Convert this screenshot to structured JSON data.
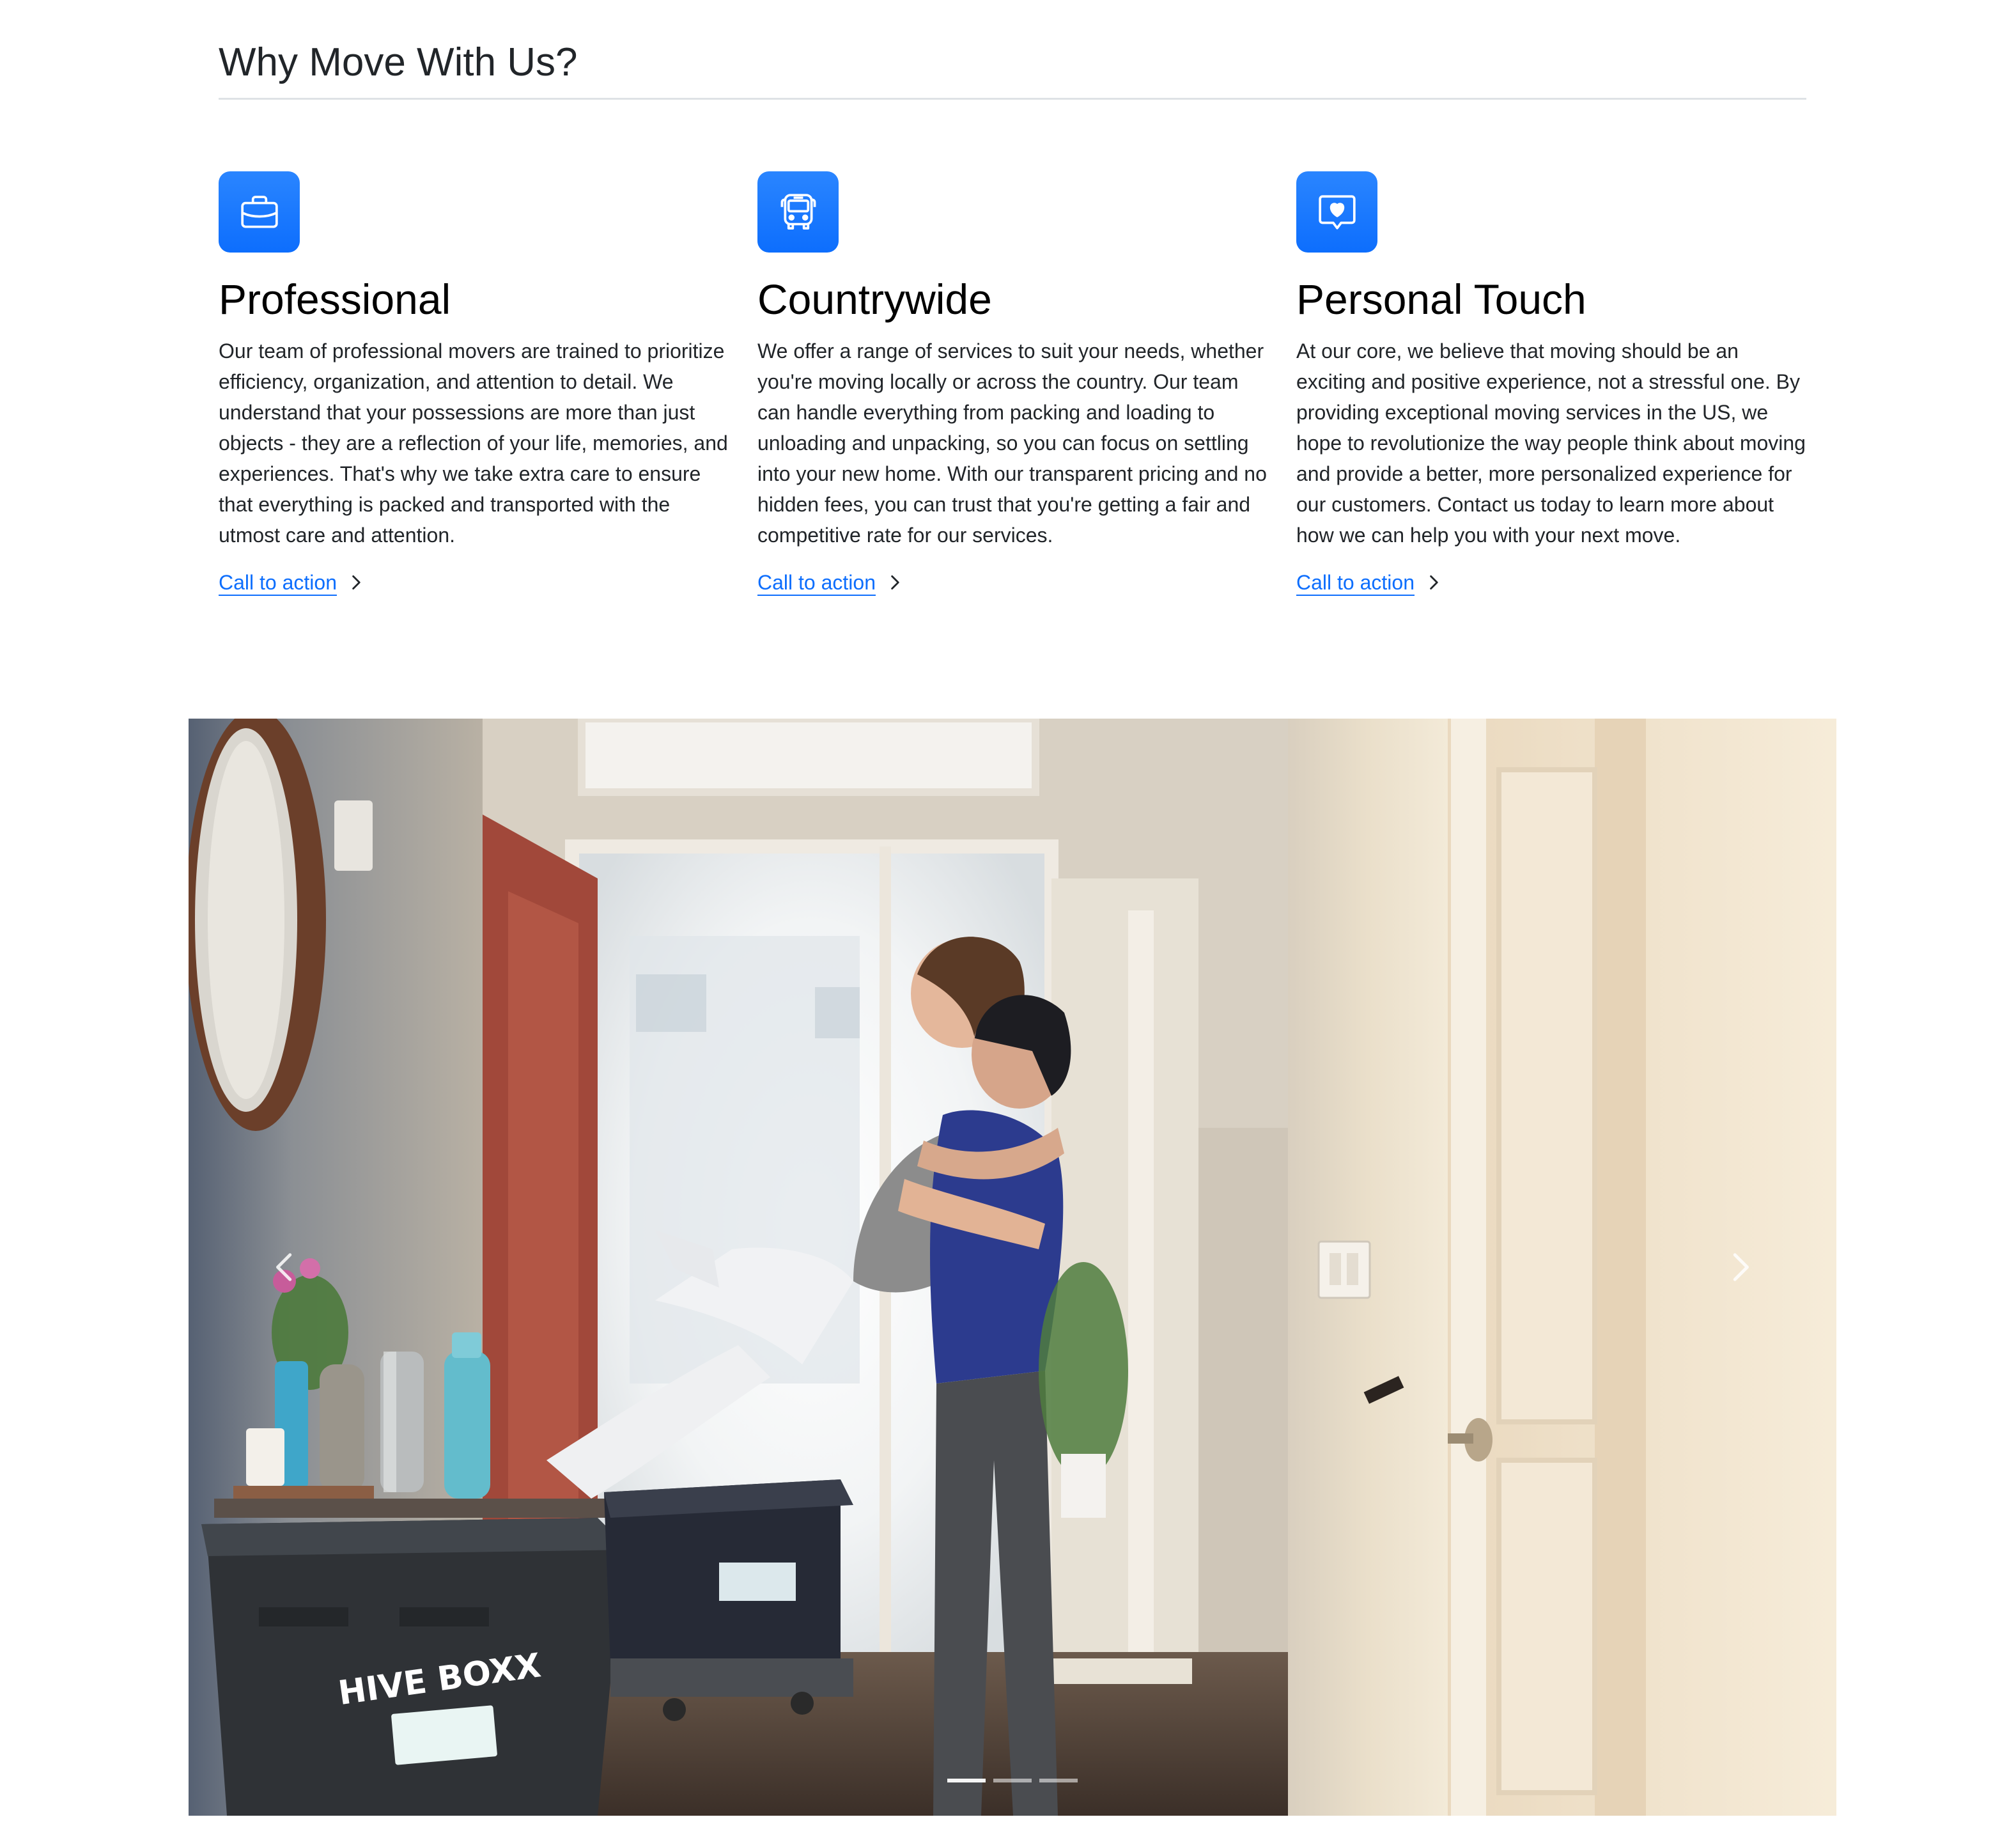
{
  "header": {
    "title": "Why Move With Us?"
  },
  "features": [
    {
      "icon": "briefcase-icon",
      "title": "Professional",
      "text": "Our team of professional movers are trained to prioritize efficiency, organization, and attention to detail. We understand that your possessions are more than just objects - they are a reflection of your life, memories, and experiences. That's why we take extra care to ensure that everything is packed and transported with the utmost care and attention.",
      "cta": "Call to action"
    },
    {
      "icon": "bus-icon",
      "title": "Countrywide",
      "text": "We offer a range of services to suit your needs, whether you're moving locally or across the country. Our team can handle everything from packing and loading to unloading and unpacking, so you can focus on settling into your new home. With our transparent pricing and no hidden fees, you can trust that you're getting a fair and competitive rate for our services.",
      "cta": "Call to action"
    },
    {
      "icon": "chat-heart-icon",
      "title": "Personal Touch",
      "text": "At our core, we believe that moving should be an exciting and positive experience, not a stressful one. By providing exceptional moving services in the US, we hope to revolutionize the way people think about moving and provide a better, more personalized experience for our customers. Contact us today to learn more about how we can help you with your next move.",
      "cta": "Call to action"
    }
  ],
  "carousel": {
    "slide_count": 3,
    "active_slide": 1,
    "box_logo_text": "HIVE BOXX"
  },
  "colors": {
    "accent": "#0d6efd",
    "icon_bg": "#1a73ff",
    "text": "#212529",
    "divider": "#dee2e6"
  }
}
